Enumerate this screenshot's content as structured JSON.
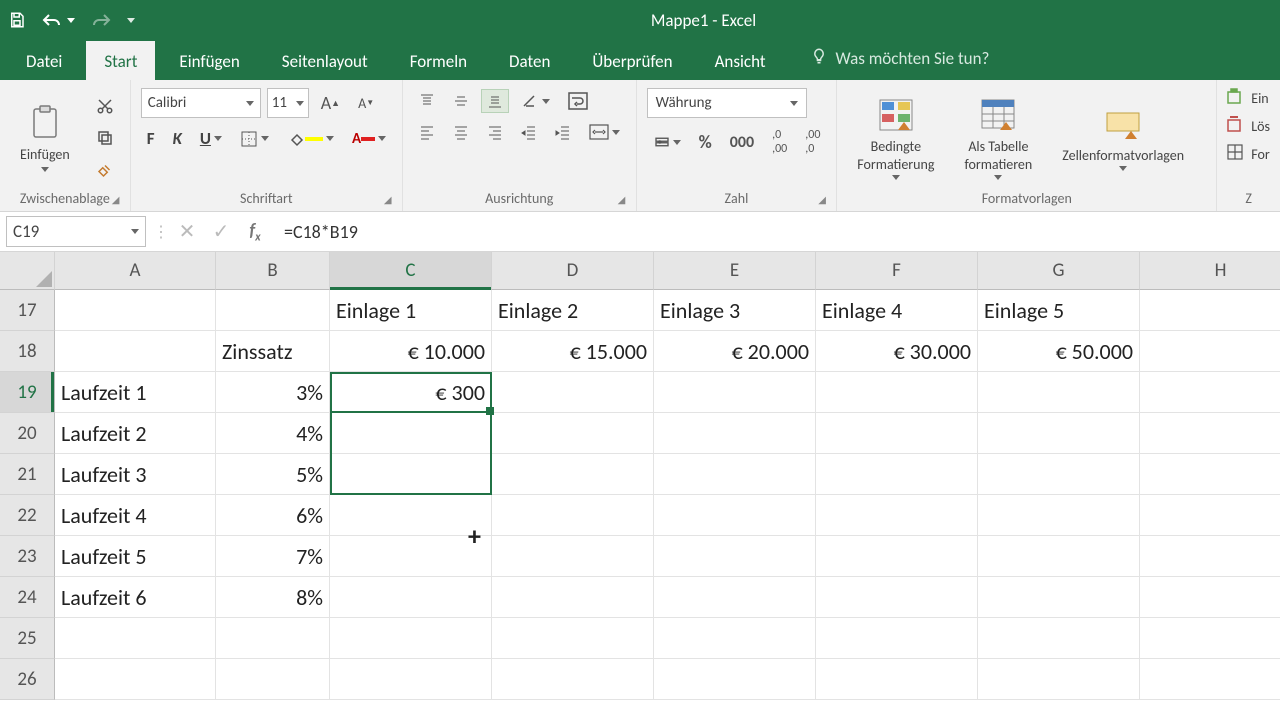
{
  "titlebar": {
    "title": "Mappe1 - Excel"
  },
  "tabs": {
    "datei": "Datei",
    "start": "Start",
    "einfuegen": "Einfügen",
    "seitenlayout": "Seitenlayout",
    "formeln": "Formeln",
    "daten": "Daten",
    "ueberpruefen": "Überprüfen",
    "ansicht": "Ansicht",
    "tellme_placeholder": "Was möchten Sie tun?"
  },
  "ribbon": {
    "clipboard_label": "Zwischenablage",
    "paste_label": "Einfügen",
    "font_label": "Schriftart",
    "font_name": "Calibri",
    "font_size": "11",
    "align_label": "Ausrichtung",
    "number_label": "Zahl",
    "number_format": "Währung",
    "styles_label": "Formatvorlagen",
    "conditional": "Bedingte\nFormatierung",
    "as_table": "Als Tabelle\nformatieren",
    "cell_styles": "Zellenformatvorlagen",
    "einf_trunc": "Ein",
    "los_trunc": "Lös",
    "for_trunc": "For"
  },
  "formula": {
    "name_box": "C19",
    "value": "=C18*B19"
  },
  "columns": [
    "A",
    "B",
    "C",
    "D",
    "E",
    "F",
    "G",
    "H"
  ],
  "rows": [
    "17",
    "18",
    "19",
    "20",
    "21",
    "22",
    "23",
    "24",
    "25",
    "26"
  ],
  "data": {
    "B18": "Zinssatz",
    "C17": "Einlage 1",
    "D17": "Einlage 2",
    "E17": "Einlage 3",
    "F17": "Einlage 4",
    "G17": "Einlage 5",
    "C18": "€ 10.000",
    "D18": "€ 15.000",
    "E18": "€ 20.000",
    "F18": "€ 30.000",
    "G18": "€ 50.000",
    "A19": "Laufzeit 1",
    "B19": "3%",
    "C19": "€ 300",
    "A20": "Laufzeit 2",
    "B20": "4%",
    "A21": "Laufzeit 3",
    "B21": "5%",
    "A22": "Laufzeit 4",
    "B22": "6%",
    "A23": "Laufzeit 5",
    "B23": "7%",
    "A24": "Laufzeit 6",
    "B24": "8%"
  },
  "selected_column": "C",
  "selected_row": "19"
}
